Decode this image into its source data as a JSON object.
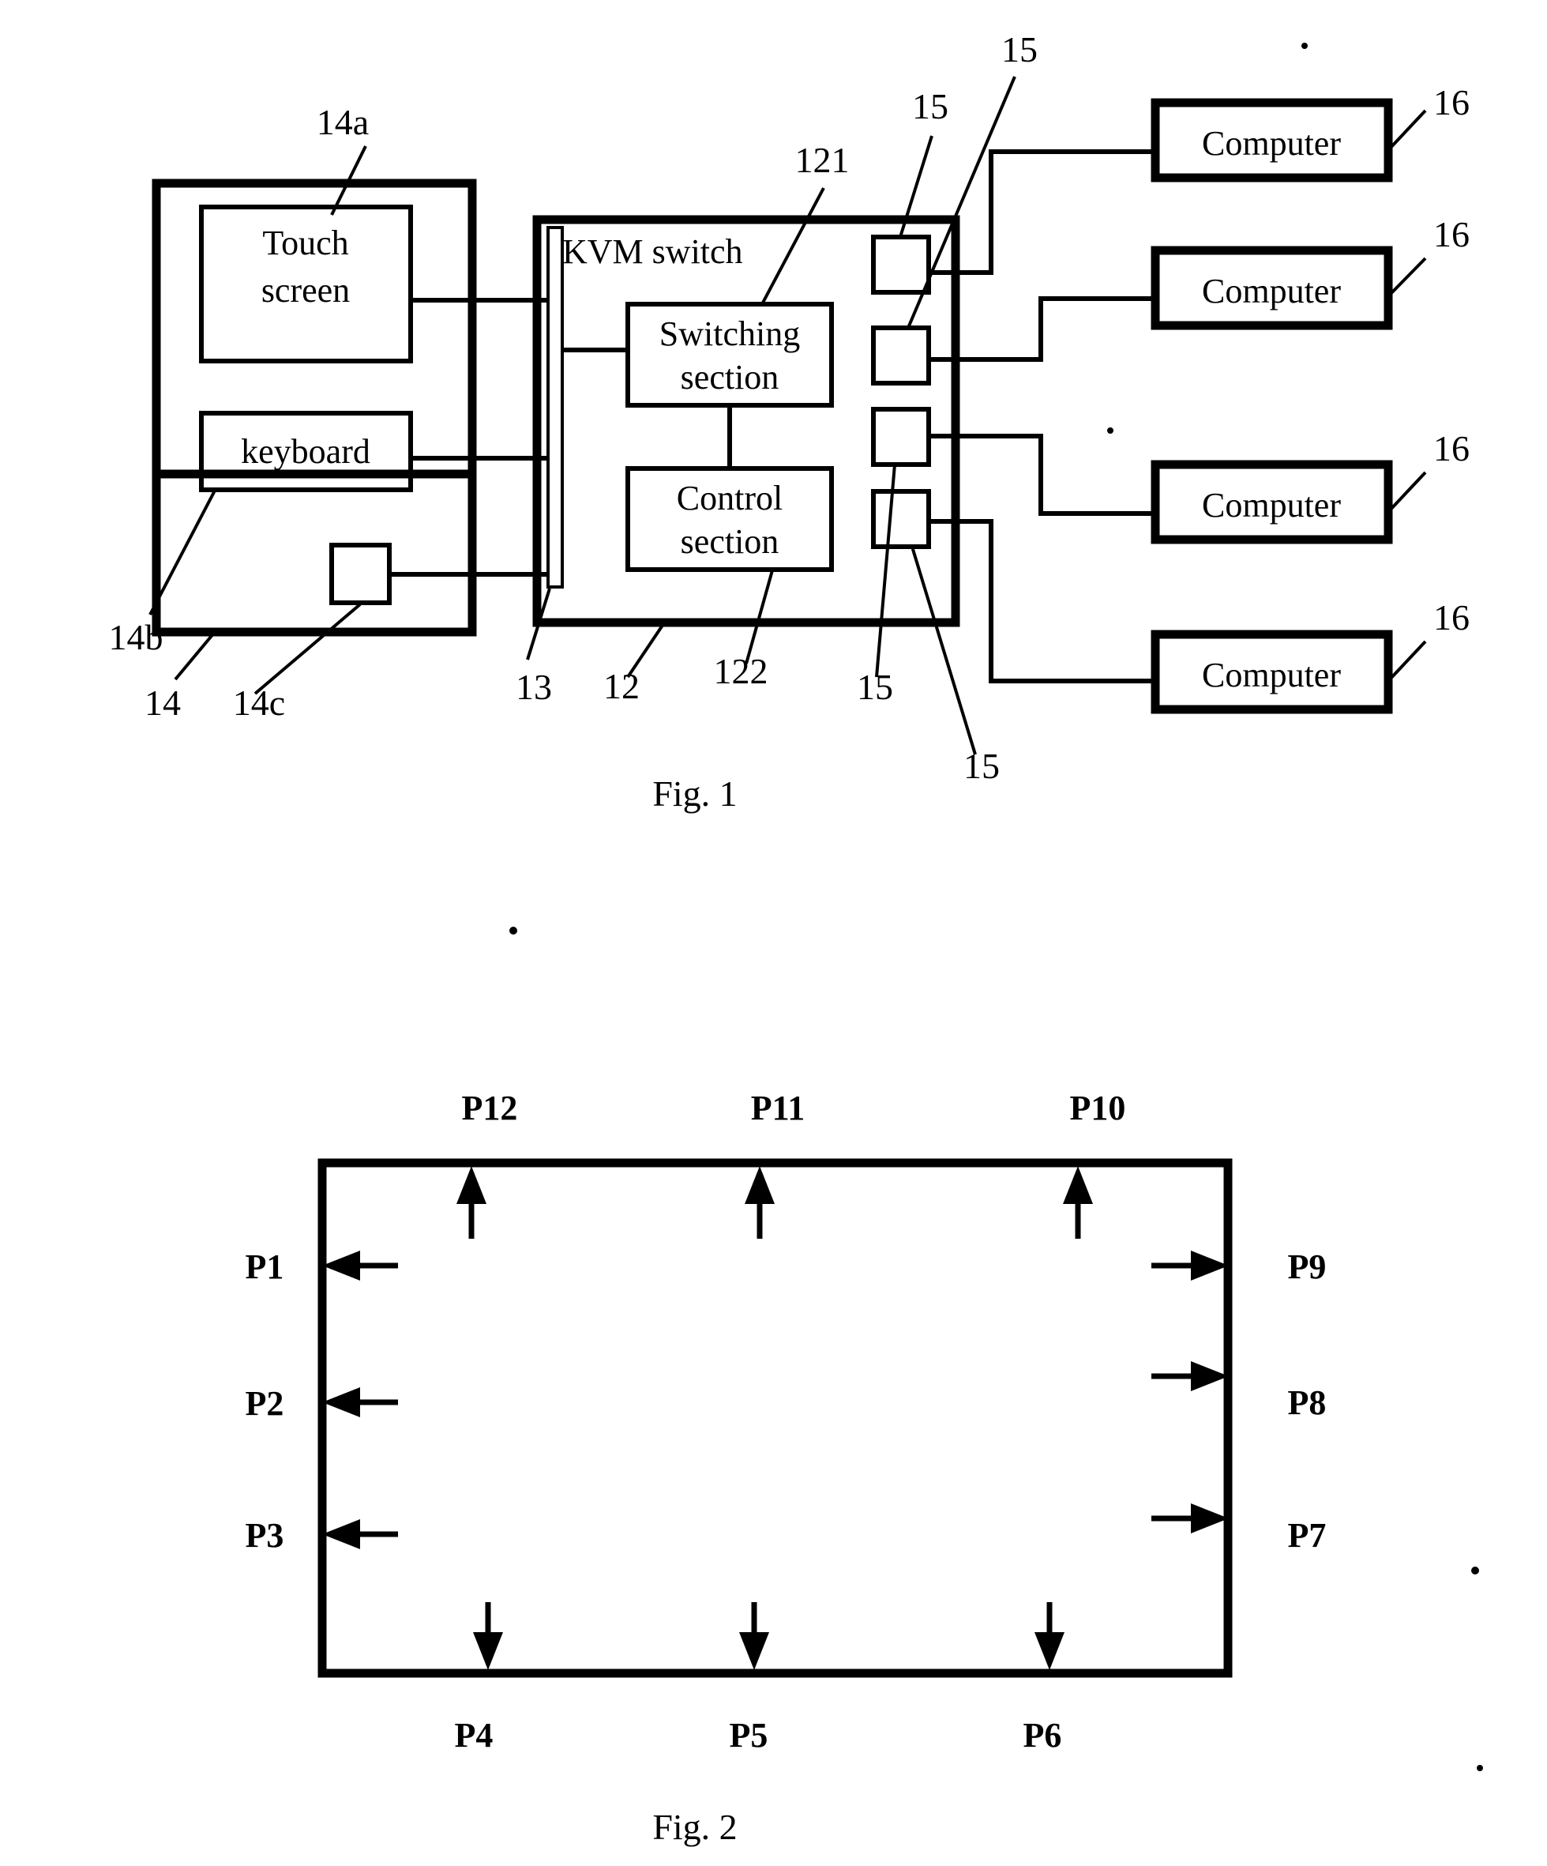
{
  "document": {
    "type": "patent-drawing-sheet",
    "figures": [
      {
        "id": "fig1",
        "caption": "Fig. 1",
        "boxes": [
          {
            "key": "touch_screen",
            "label": "Touch\nscreen",
            "line1": "Touch",
            "line2": "screen"
          },
          {
            "key": "keyboard",
            "label": "keyboard"
          },
          {
            "key": "kvm_switch",
            "label": "KVM switch"
          },
          {
            "key": "switching_section",
            "line1": "Switching",
            "line2": "section"
          },
          {
            "key": "control_section",
            "line1": "Control",
            "line2": "section"
          },
          {
            "key": "computer_1",
            "label": "Computer"
          },
          {
            "key": "computer_2",
            "label": "Computer"
          },
          {
            "key": "computer_3",
            "label": "Computer"
          },
          {
            "key": "computer_4",
            "label": "Computer"
          }
        ],
        "reference_numerals": [
          {
            "key": "ref_14a",
            "text": "14a"
          },
          {
            "key": "ref_14b",
            "text": "14b"
          },
          {
            "key": "ref_14",
            "text": "14"
          },
          {
            "key": "ref_14c",
            "text": "14c"
          },
          {
            "key": "ref_13",
            "text": "13"
          },
          {
            "key": "ref_12",
            "text": "12"
          },
          {
            "key": "ref_121",
            "text": "121"
          },
          {
            "key": "ref_122",
            "text": "122"
          },
          {
            "key": "ref_15_top",
            "text": "15"
          },
          {
            "key": "ref_15_upper",
            "text": "15"
          },
          {
            "key": "ref_15_lower",
            "text": "15"
          },
          {
            "key": "ref_15_bottom",
            "text": "15"
          },
          {
            "key": "ref_16_1",
            "text": "16"
          },
          {
            "key": "ref_16_2",
            "text": "16"
          },
          {
            "key": "ref_16_3",
            "text": "16"
          },
          {
            "key": "ref_16_4",
            "text": "16"
          }
        ]
      },
      {
        "id": "fig2",
        "caption": "Fig. 2",
        "port_labels": {
          "left": [
            "P1",
            "P2",
            "P3"
          ],
          "bottom": [
            "P4",
            "P5",
            "P6"
          ],
          "right_bottom_to_top": [
            "P7",
            "P8",
            "P9"
          ],
          "top_right_to_left": [
            "P10",
            "P11",
            "P12"
          ]
        },
        "ports": [
          {
            "key": "port_p1",
            "text": "P1",
            "edge": "left",
            "direction": "outward-left"
          },
          {
            "key": "port_p2",
            "text": "P2",
            "edge": "left",
            "direction": "outward-left"
          },
          {
            "key": "port_p3",
            "text": "P3",
            "edge": "left",
            "direction": "outward-left"
          },
          {
            "key": "port_p4",
            "text": "P4",
            "edge": "bottom",
            "direction": "outward-down"
          },
          {
            "key": "port_p5",
            "text": "P5",
            "edge": "bottom",
            "direction": "outward-down"
          },
          {
            "key": "port_p6",
            "text": "P6",
            "edge": "bottom",
            "direction": "outward-down"
          },
          {
            "key": "port_p7",
            "text": "P7",
            "edge": "right",
            "direction": "outward-right"
          },
          {
            "key": "port_p8",
            "text": "P8",
            "edge": "right",
            "direction": "outward-right"
          },
          {
            "key": "port_p9",
            "text": "P9",
            "edge": "right",
            "direction": "outward-right"
          },
          {
            "key": "port_p10",
            "text": "P10",
            "edge": "top",
            "direction": "outward-up"
          },
          {
            "key": "port_p11",
            "text": "P11",
            "edge": "top",
            "direction": "outward-up"
          },
          {
            "key": "port_p12",
            "text": "P12",
            "edge": "top",
            "direction": "outward-up"
          }
        ]
      }
    ]
  },
  "fig1": {
    "touch_screen_line1": "Touch",
    "touch_screen_line2": "screen",
    "keyboard": "keyboard",
    "kvm_switch": "KVM switch",
    "switching_line1": "Switching",
    "switching_line2": "section",
    "control_line1": "Control",
    "control_line2": "section",
    "computer_1": "Computer",
    "computer_2": "Computer",
    "computer_3": "Computer",
    "computer_4": "Computer",
    "ref_14a": "14a",
    "ref_14b": "14b",
    "ref_14": "14",
    "ref_14c": "14c",
    "ref_13": "13",
    "ref_12": "12",
    "ref_121": "121",
    "ref_122": "122",
    "ref_15_a": "15",
    "ref_15_b": "15",
    "ref_15_c": "15",
    "ref_15_d": "15",
    "ref_16_a": "16",
    "ref_16_b": "16",
    "ref_16_c": "16",
    "ref_16_d": "16",
    "caption": "Fig. 1"
  },
  "fig2": {
    "p1": "P1",
    "p2": "P2",
    "p3": "P3",
    "p4": "P4",
    "p5": "P5",
    "p6": "P6",
    "p7": "P7",
    "p8": "P8",
    "p9": "P9",
    "p10": "P10",
    "p11": "P11",
    "p12": "P12",
    "caption": "Fig. 2"
  },
  "colors": {
    "ink": "#000000",
    "paper": "#ffffff"
  }
}
